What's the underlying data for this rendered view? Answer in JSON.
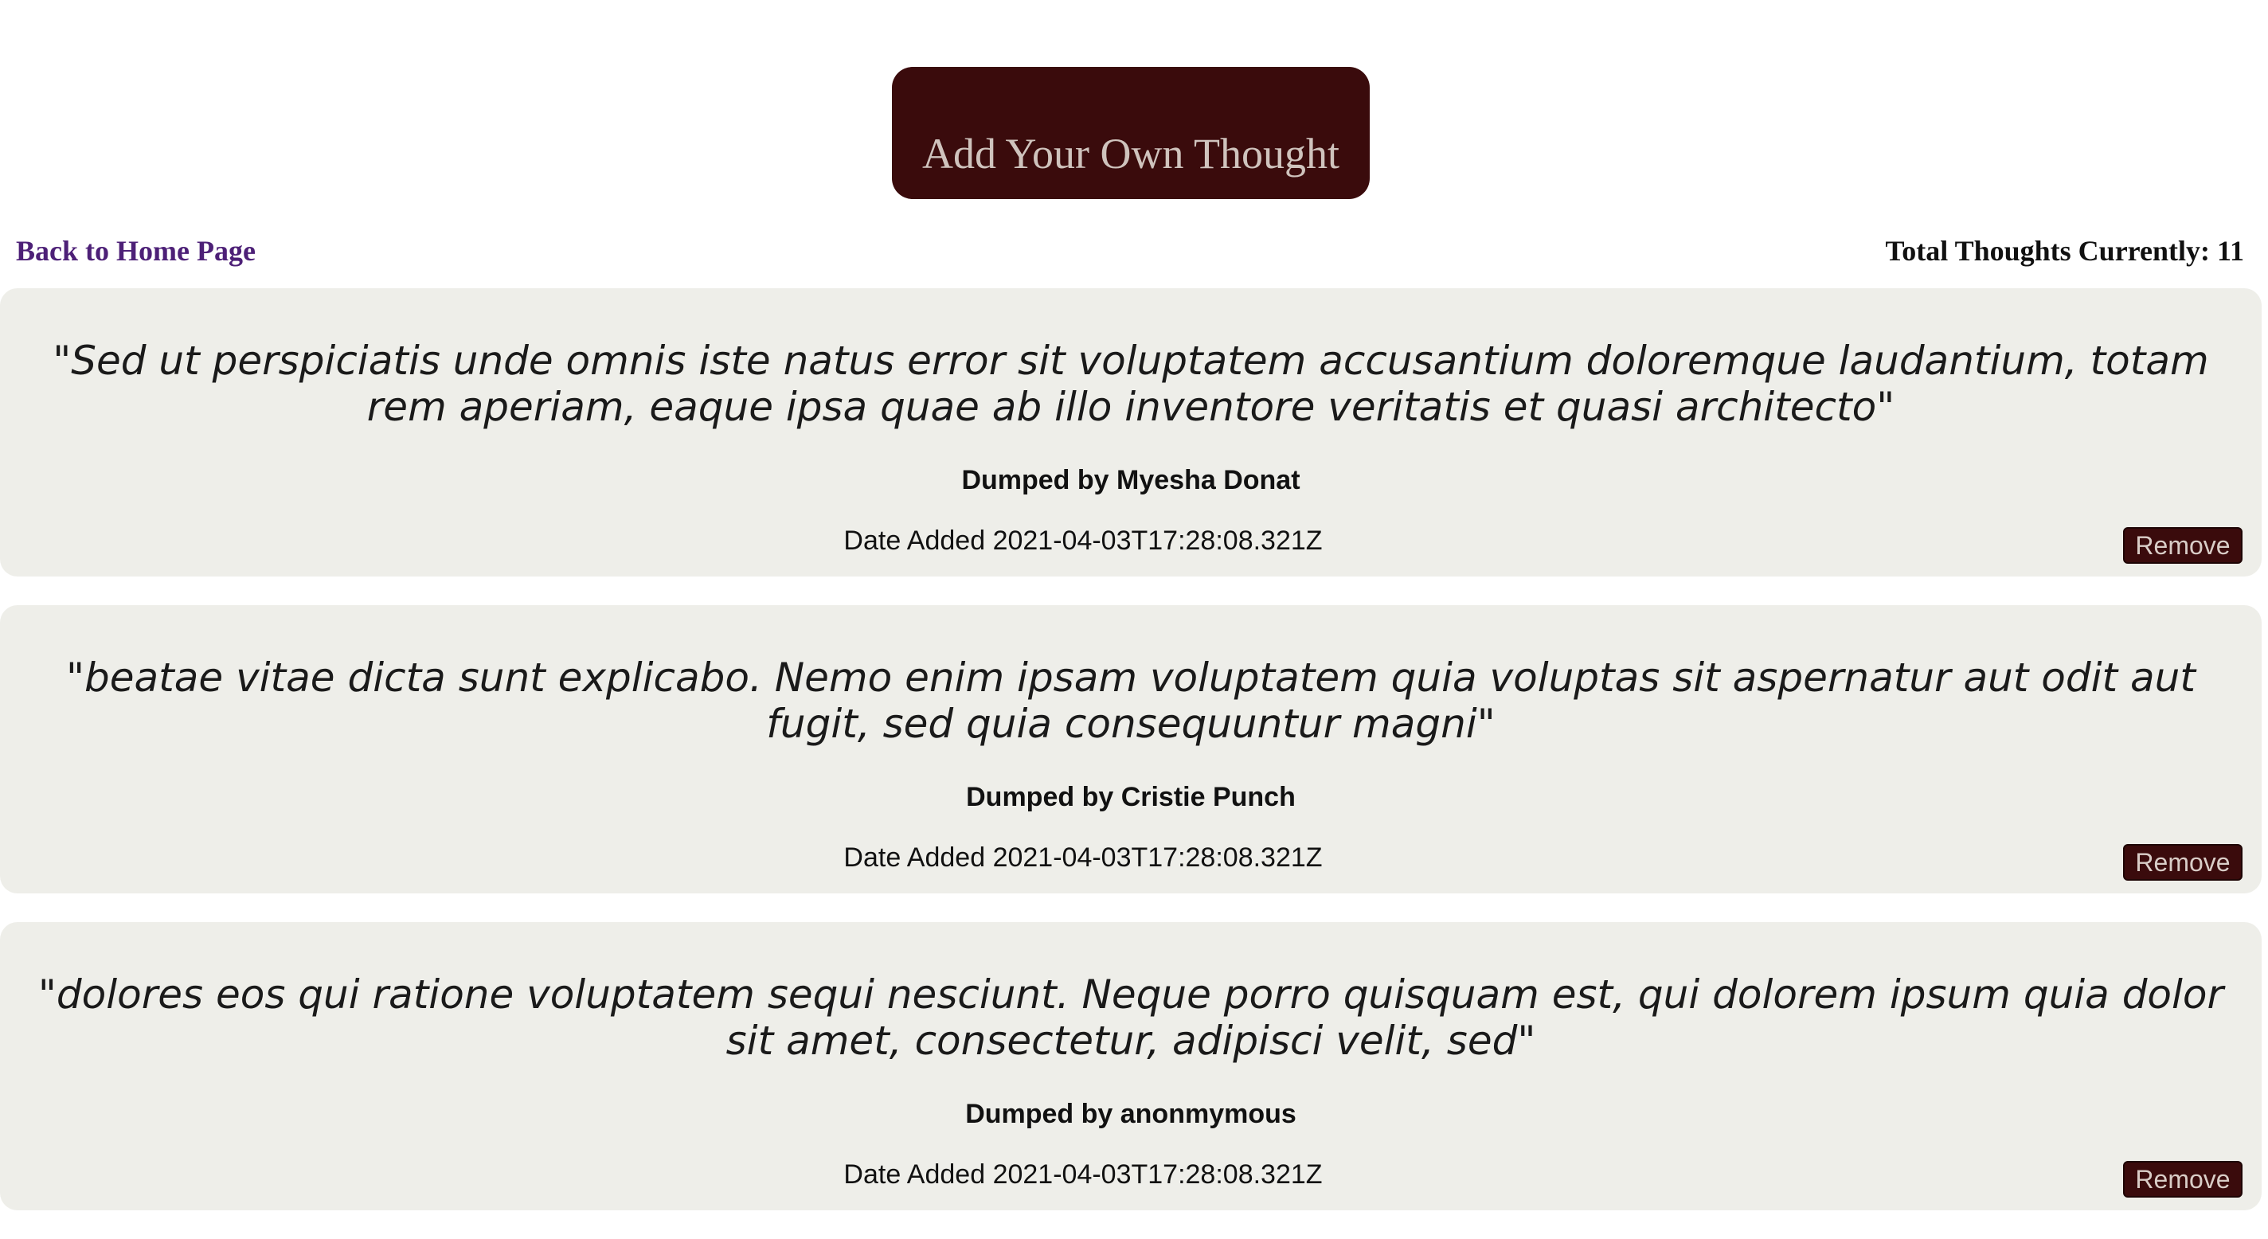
{
  "header": {
    "add_button_label": "Add Your Own Thought"
  },
  "nav": {
    "back_link_label": "Back to Home Page",
    "total_label": "Total Thoughts Currently: 11"
  },
  "thoughts": [
    {
      "quote": "\"Sed ut perspiciatis unde omnis iste natus error sit voluptatem accusantium doloremque laudantium, totam rem aperiam, eaque ipsa quae ab illo inventore veritatis et quasi architecto\"",
      "author": "Dumped by Myesha Donat",
      "date": "Date Added 2021-04-03T17:28:08.321Z",
      "remove_label": "Remove"
    },
    {
      "quote": "\"beatae vitae dicta sunt explicabo. Nemo enim ipsam voluptatem quia voluptas sit aspernatur aut odit aut fugit, sed quia consequuntur magni\"",
      "author": "Dumped by Cristie Punch",
      "date": "Date Added 2021-04-03T17:28:08.321Z",
      "remove_label": "Remove"
    },
    {
      "quote": "\"dolores eos qui ratione voluptatem sequi nesciunt. Neque porro quisquam est, qui dolorem ipsum quia dolor sit amet, consectetur, adipisci velit, sed\"",
      "author": "Dumped by anonmymous",
      "date": "Date Added 2021-04-03T17:28:08.321Z",
      "remove_label": "Remove"
    }
  ],
  "colors": {
    "accent_dark": "#3a0b0c",
    "link": "#4d2077",
    "card_background": "#eeeee9"
  }
}
